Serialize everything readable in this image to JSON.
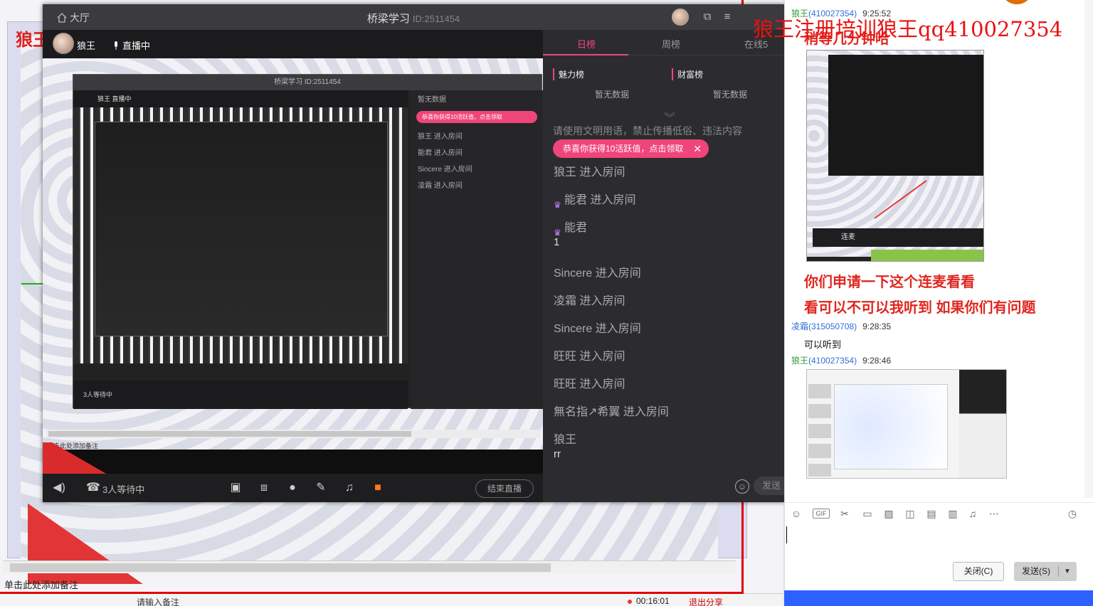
{
  "window": {
    "lobby_label": "大厅",
    "room_title": "桥梁学习",
    "room_id": "ID:2511454",
    "host_name": "狼王",
    "live_status": "直播中",
    "waiting_text": "3人等待中",
    "end_live_label": "结束直播"
  },
  "side": {
    "tabs": [
      "日榜",
      "周榜",
      "在线5"
    ],
    "charm_label": "魅力榜",
    "wealth_label": "财富榜",
    "no_data": "暂无数据",
    "notice": "请使用文明用语，禁止传播低俗、违法内容",
    "reward_pill": "恭喜你获得10活跃值，点击领取",
    "chat": [
      {
        "text": "狼王 进入房间",
        "sub": ""
      },
      {
        "text": "能君 进入房间",
        "sub": ""
      },
      {
        "text": "能君",
        "sub": "1"
      },
      {
        "text": "Sincere 进入房间",
        "sub": ""
      },
      {
        "text": "凌霜 进入房间",
        "sub": ""
      },
      {
        "text": "Sincere 进入房间",
        "sub": ""
      },
      {
        "text": "旺旺 进入房间",
        "sub": ""
      },
      {
        "text": "旺旺 进入房间",
        "sub": ""
      },
      {
        "text": "無名指↗希翼 进入房间",
        "sub": ""
      },
      {
        "text": "狼王",
        "sub": "rr"
      }
    ],
    "send_label": "发送"
  },
  "watermark": "狼王注册培训狼王qq410027354",
  "background": {
    "logo_text": "狼王",
    "note_text": "单击此处添加备注",
    "status_notes": "请输入备注",
    "timer": "00:16:01",
    "exit_label": "退出分享"
  },
  "qq": {
    "messages": [
      {
        "name": "狼王",
        "qqid": "(410027354)",
        "time": "9:25:52"
      },
      {
        "name": "凌霜",
        "qqid": "(315050708)",
        "time": "9:28:35"
      },
      {
        "name": "狼王",
        "qqid": "(410027354)",
        "time": "9:28:46"
      }
    ],
    "big_lines": [
      "稍等几分钟哈",
      "你们申请一下这个连麦看看",
      "看可以不可以我听到  如果你们有问题"
    ],
    "reply": "可以听到",
    "shot_label": "连麦",
    "close_label": "关闭(C)",
    "send_label": "发送(S)"
  },
  "colors": {
    "accent_pink": "#f0457a",
    "watermark_red": "#ea1111",
    "qq_green": "#2c9b3a",
    "qq_blue": "#2e6fd6"
  }
}
